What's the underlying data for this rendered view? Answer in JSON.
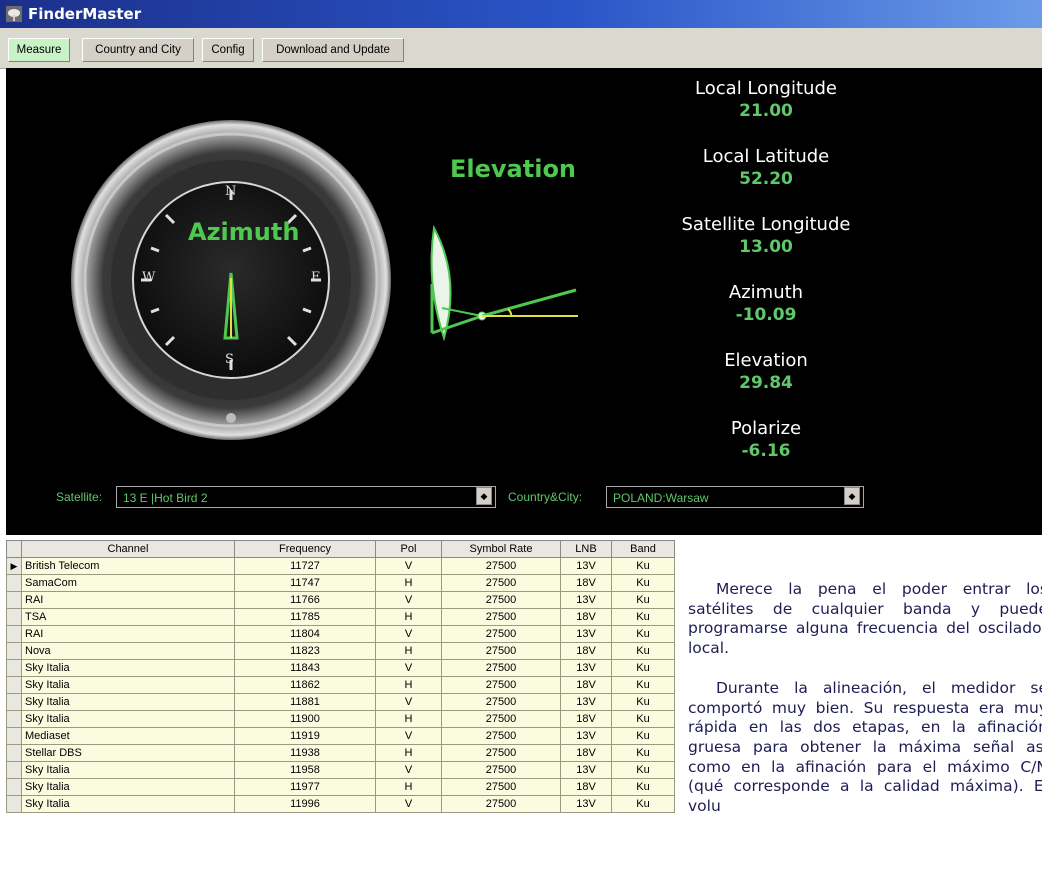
{
  "window": {
    "title": "FinderMaster"
  },
  "tabs": [
    {
      "label": "Measure"
    },
    {
      "label": "Country and City"
    },
    {
      "label": "Config"
    },
    {
      "label": "Download and Update"
    }
  ],
  "compass": {
    "title": "Azimuth",
    "north": "N",
    "south": "S",
    "east": "E",
    "west": "W"
  },
  "elevation_gauge": {
    "title": "Elevation"
  },
  "readings": [
    {
      "label": "Local Longitude",
      "value": "21.00"
    },
    {
      "label": "Local Latitude",
      "value": "52.20"
    },
    {
      "label": "Satellite Longitude",
      "value": "13.00"
    },
    {
      "label": "Azimuth",
      "value": "-10.09"
    },
    {
      "label": "Elevation",
      "value": "29.84"
    },
    {
      "label": "Polarize",
      "value": "-6.16"
    }
  ],
  "selectors": {
    "satellite_label": "Satellite:",
    "satellite_value": "13 E    |Hot Bird 2",
    "country_label": "Country&City:",
    "country_value": "POLAND:Warsaw"
  },
  "table": {
    "columns": [
      "Channel",
      "Frequency",
      "Pol",
      "Symbol Rate",
      "LNB",
      "Band"
    ],
    "rows": [
      [
        "British Telecom",
        "11727",
        "V",
        "27500",
        "13V",
        "Ku"
      ],
      [
        "SamaCom",
        "11747",
        "H",
        "27500",
        "18V",
        "Ku"
      ],
      [
        "RAI",
        "11766",
        "V",
        "27500",
        "13V",
        "Ku"
      ],
      [
        "TSA",
        "11785",
        "H",
        "27500",
        "18V",
        "Ku"
      ],
      [
        "RAI",
        "11804",
        "V",
        "27500",
        "13V",
        "Ku"
      ],
      [
        "Nova",
        "11823",
        "H",
        "27500",
        "18V",
        "Ku"
      ],
      [
        "Sky Italia",
        "11843",
        "V",
        "27500",
        "13V",
        "Ku"
      ],
      [
        "Sky Italia",
        "11862",
        "H",
        "27500",
        "18V",
        "Ku"
      ],
      [
        "Sky Italia",
        "11881",
        "V",
        "27500",
        "13V",
        "Ku"
      ],
      [
        "Sky Italia",
        "11900",
        "H",
        "27500",
        "18V",
        "Ku"
      ],
      [
        "Mediaset",
        "11919",
        "V",
        "27500",
        "13V",
        "Ku"
      ],
      [
        "Stellar DBS",
        "11938",
        "H",
        "27500",
        "18V",
        "Ku"
      ],
      [
        "Sky Italia",
        "11958",
        "V",
        "27500",
        "13V",
        "Ku"
      ],
      [
        "Sky Italia",
        "11977",
        "H",
        "27500",
        "18V",
        "Ku"
      ],
      [
        "Sky Italia",
        "11996",
        "V",
        "27500",
        "13V",
        "Ku"
      ]
    ]
  },
  "article": {
    "paragraphs": [
      "Merece la pena el poder entrar los satélites de cualquier banda y puede programarse alguna frecuencia del oscilador local.",
      "Durante la alineación, el medidor se comportó muy bien. Su respuesta era muy rápida en las dos etapas, en la afinación gruesa para obtener la máxima señal así como en la afinación para el máximo C/N (qué corresponde a la calidad máxima). El volu"
    ]
  },
  "colors": {
    "accent_green": "#5ec86a",
    "panel_bg": "#000000",
    "row_bg": "#fbfbe0"
  }
}
